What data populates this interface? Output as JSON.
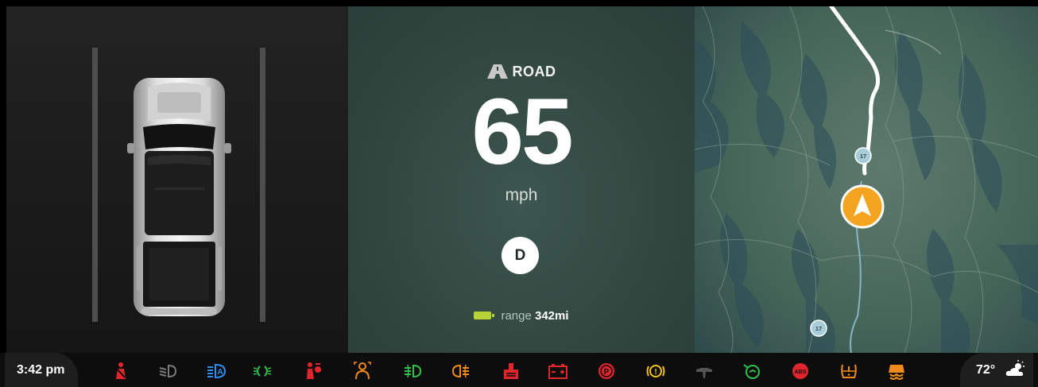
{
  "drive_mode": {
    "label": "ROAD",
    "icon": "road-icon"
  },
  "speed": {
    "value": "65",
    "unit": "mph"
  },
  "gear": "D",
  "range": {
    "label": "range",
    "value": "342mi",
    "battery_color": "#b5d334"
  },
  "map": {
    "route_shields": [
      "17",
      "17"
    ],
    "position_marker_color": "#f4a41e"
  },
  "status_bar": {
    "time": "3:42 pm",
    "temperature": "72°",
    "weather_icon": "partly-cloudy-icon",
    "telltales": [
      {
        "name": "seatbelt-warning-icon",
        "color": "#e0262c"
      },
      {
        "name": "low-beam-icon",
        "color": "#7a7a7a"
      },
      {
        "name": "auto-high-beam-icon",
        "color": "#2f8ff0"
      },
      {
        "name": "parking-lights-icon",
        "color": "#2fc24a"
      },
      {
        "name": "airbag-warning-icon",
        "color": "#e0262c"
      },
      {
        "name": "driver-monitor-icon",
        "color": "#f08a1c"
      },
      {
        "name": "front-fog-light-icon",
        "color": "#2fc24a"
      },
      {
        "name": "rear-fog-light-icon",
        "color": "#f08a1c"
      },
      {
        "name": "coolant-warning-icon",
        "color": "#e0262c"
      },
      {
        "name": "battery-warning-icon",
        "color": "#e0262c"
      },
      {
        "name": "parking-brake-icon",
        "color": "#e0262c"
      },
      {
        "name": "brake-warning-icon",
        "color": "#f0c21c"
      },
      {
        "name": "power-steering-icon",
        "color": "#555555"
      },
      {
        "name": "steering-assist-icon",
        "color": "#2fc24a"
      },
      {
        "name": "abs-warning-icon",
        "color": "#e0262c"
      },
      {
        "name": "tire-pressure-icon",
        "color": "#f08a1c"
      },
      {
        "name": "stability-control-icon",
        "color": "#f08a1c"
      }
    ]
  }
}
